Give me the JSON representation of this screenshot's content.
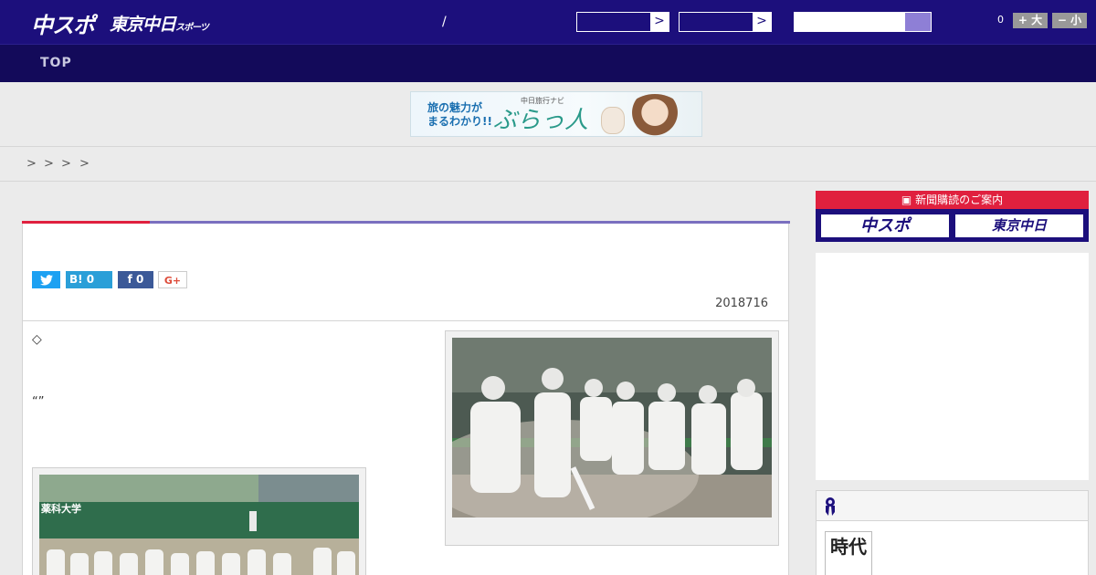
{
  "header": {
    "logo_primary": "中スポ",
    "logo_secondary": "東京中日",
    "logo_secondary_small": "スポーツ",
    "separator": "/",
    "select1_arrow": ">",
    "select2_arrow": ">",
    "search_value": "",
    "font_count": "0",
    "font_larger": "+ 大",
    "font_smaller": "− 小"
  },
  "nav": {
    "top_label": "TOP"
  },
  "ad_banner": {
    "line1": "旅の魅力が",
    "line2": "まるわかり!!",
    "brand_small": "中日旅行ナビ",
    "brand": "ぶらっ人"
  },
  "breadcrumbs": [
    ">",
    ">",
    ">",
    ">"
  ],
  "article": {
    "share_twitter": "🐦",
    "share_hatena": "B! 0",
    "share_facebook": "f  0",
    "share_google": "G+",
    "date": "2018716",
    "lead_symbol": "◇",
    "quote": "“”"
  },
  "sidebar": {
    "subscribe_header": "新聞購読のご案内",
    "subscribe_tile1": "中スポ",
    "subscribe_tile2": "東京中日",
    "ranking_thumb_text": "時代"
  },
  "colors": {
    "header_bg": "#1c0f7c",
    "nav_bg": "#130a5a",
    "accent_red": "#e0203e",
    "accent_purple": "#7a6fbf"
  }
}
